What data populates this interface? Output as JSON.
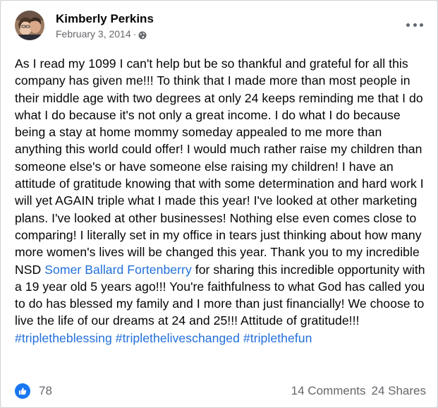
{
  "post": {
    "author": "Kimberly Perkins",
    "date": "February 3, 2014",
    "separator": "·",
    "privacy_icon": "globe-icon",
    "more_icon": "more-horizontal-icon",
    "text_before_mention": "As I read my 1099 I can't help but be so thankful and grateful for all this company has given me!!! To think that I made more than most people in their middle age with two degrees at only 24 keeps reminding me that I do what I do because it's not only a great income. I do what I do because being a stay at home mommy someday appealed to me more than anything this world could offer! I would much rather raise my children than someone else's or have someone else raising my children! I have an attitude of gratitude knowing that with some determination and hard work I will yet AGAIN triple what I made this year! I've looked at other marketing plans. I've looked at other businesses! Nothing else even comes close to comparing! I literally set in my office in tears just thinking about how many more women's lives will be changed this year. Thank you to my incredible NSD",
    "mention": "Somer Ballard Fortenberry",
    "text_after_mention": "for sharing this incredible opportunity with a 19 year old 5 years ago!!! You're faithfulness to what God has called you to do has blessed my family and I more than just financially! We choose to live the life of our dreams at 24 and 25!!! Attitude of gratitude!!!",
    "hashtags": [
      "#tripletheblessing",
      "#tripletheliveschanged",
      "#triplethefun"
    ]
  },
  "footer": {
    "like_icon": "thumbs-up-icon",
    "like_count": "78",
    "comments": "14 Comments",
    "shares": "24 Shares"
  },
  "colors": {
    "link": "#216fdb",
    "like_badge": "#1877f2",
    "secondary_text": "#65676b"
  }
}
